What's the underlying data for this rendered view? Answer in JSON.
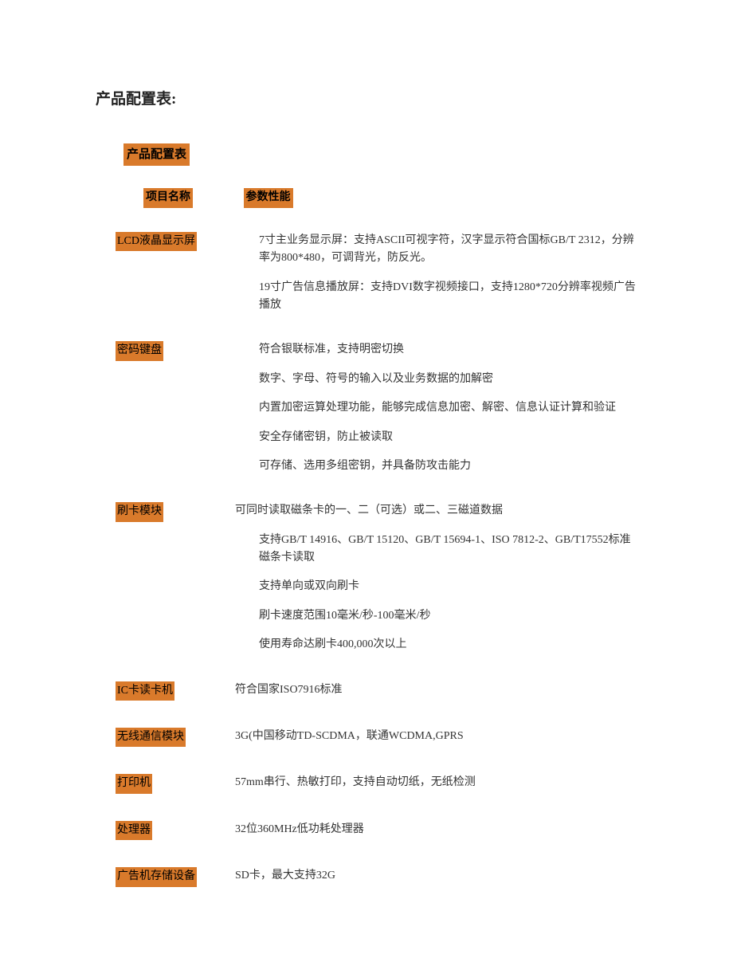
{
  "doc_title": "产品配置表:",
  "section_heading": "产品配置表",
  "column_headers": {
    "item": "项目名称",
    "spec": "参数性能"
  },
  "rows": [
    {
      "label": "LCD液晶显示屏",
      "specs": [
        {
          "text": "7寸主业务显示屏：支持ASCII可视字符，汉字显示符合国标GB/T 2312，分辨率为800*480，可调背光，防反光。",
          "indent": true
        },
        {
          "text": "19寸广告信息播放屏：支持DVI数字视频接口，支持1280*720分辨率视频广告播放",
          "indent": true
        }
      ]
    },
    {
      "label": "密码键盘",
      "specs": [
        {
          "text": "符合银联标准，支持明密切换",
          "indent": true
        },
        {
          "text": "数字、字母、符号的输入以及业务数据的加解密",
          "indent": true
        },
        {
          "text": "内置加密运算处理功能，能够完成信息加密、解密、信息认证计算和验证",
          "indent": true
        },
        {
          "text": "安全存储密钥，防止被读取",
          "indent": true
        },
        {
          "text": "可存储、选用多组密钥，并具备防攻击能力",
          "indent": true
        }
      ]
    },
    {
      "label": "刷卡模块",
      "specs": [
        {
          "text": "可同时读取磁条卡的一、二（可选）或二、三磁道数据",
          "indent": false
        },
        {
          "text": "支持GB/T 14916、GB/T 15120、GB/T 15694-1、ISO 7812-2、GB/T17552标准磁条卡读取",
          "indent": true
        },
        {
          "text": "支持单向或双向刷卡",
          "indent": true
        },
        {
          "text": "刷卡速度范围10毫米/秒-100毫米/秒",
          "indent": true
        },
        {
          "text": "使用寿命达刷卡400,000次以上",
          "indent": true
        }
      ]
    },
    {
      "label": "IC卡读卡机",
      "specs": [
        {
          "text": "符合国家ISO7916标准",
          "indent": false
        }
      ]
    },
    {
      "label": "无线通信模块",
      "specs": [
        {
          "text": "3G(中国移动TD-SCDMA，联通WCDMA,GPRS",
          "indent": false
        }
      ]
    },
    {
      "label": "打印机",
      "specs": [
        {
          "text": "57mm串行、热敏打印，支持自动切纸，无纸检测",
          "indent": false
        }
      ]
    },
    {
      "label": "处理器",
      "specs": [
        {
          "text": "32位360MHz低功耗处理器",
          "indent": false
        }
      ]
    },
    {
      "label": "广告机存储设备",
      "specs": [
        {
          "text": "SD卡，最大支持32G",
          "indent": false
        }
      ]
    }
  ]
}
